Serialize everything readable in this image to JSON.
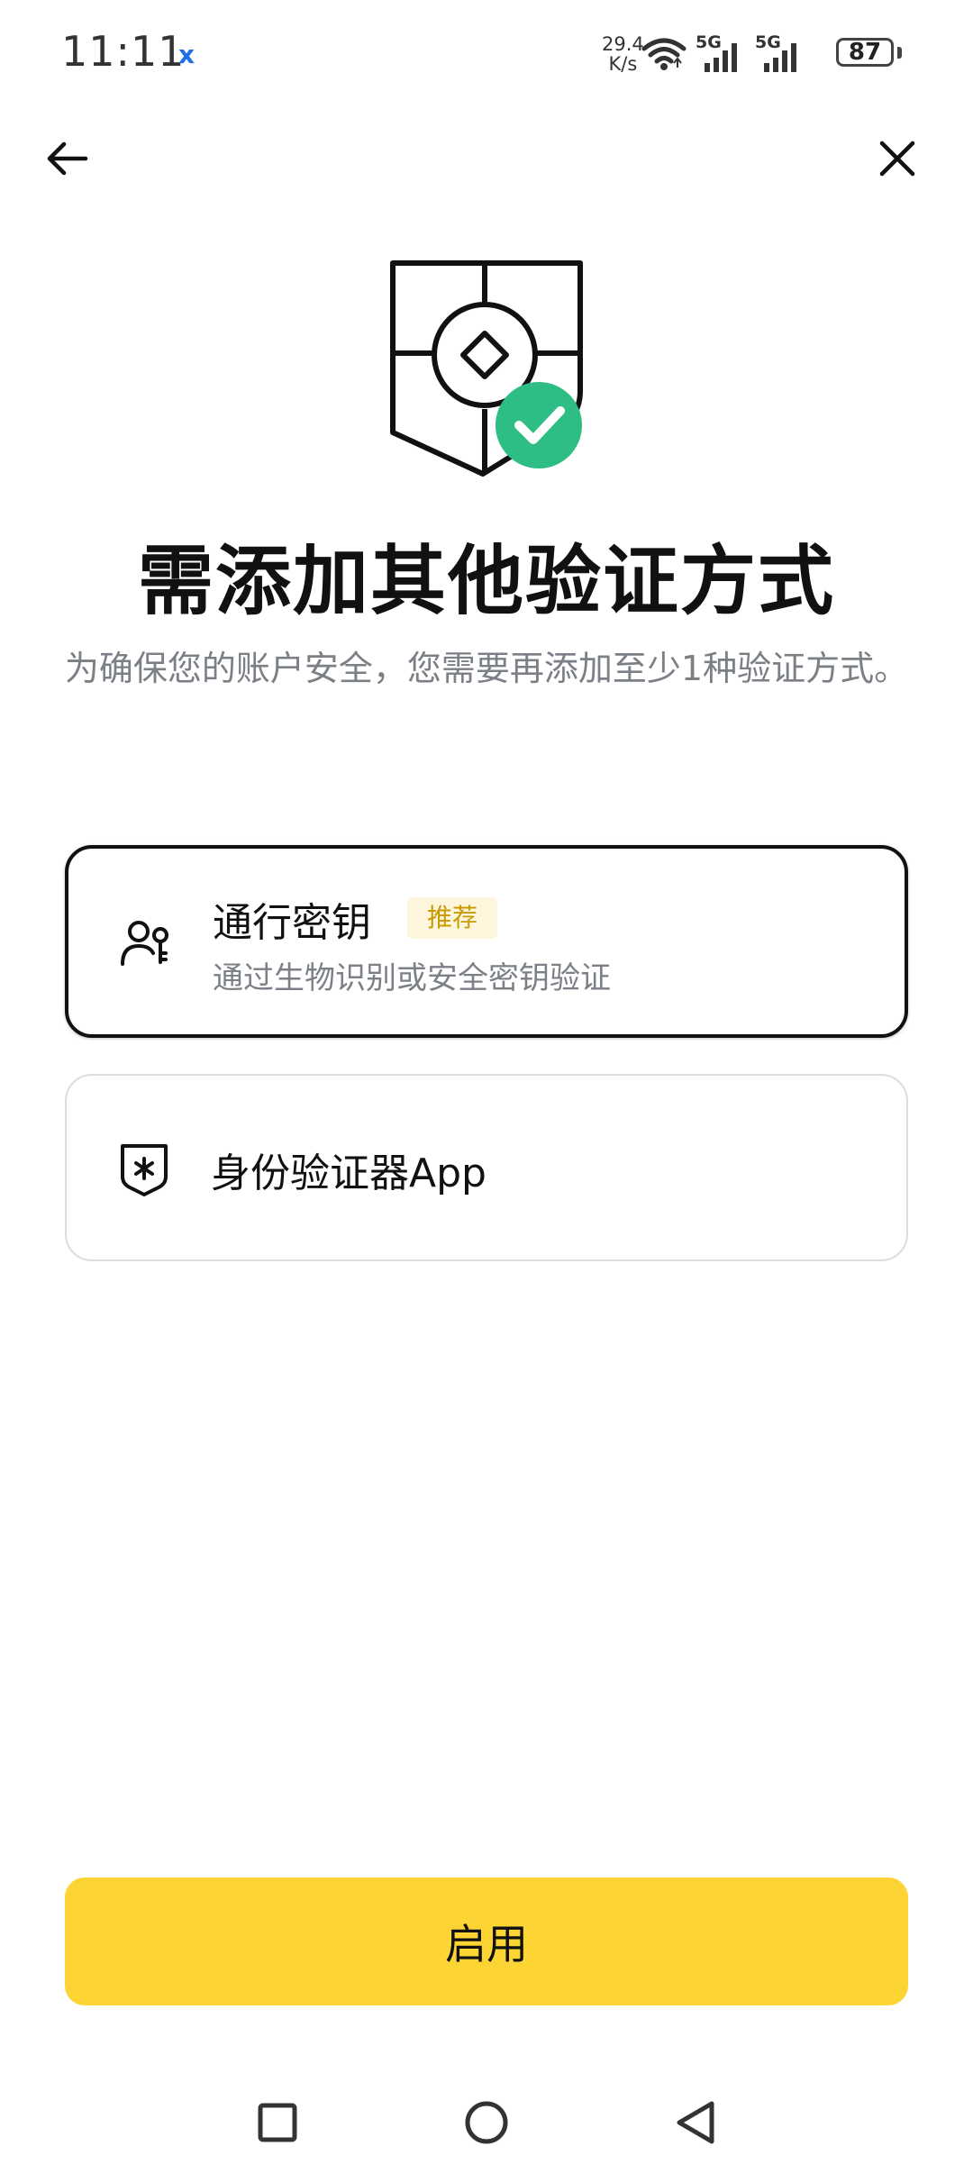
{
  "status_bar": {
    "time": "11:11",
    "notification_glyph": "x",
    "net_speed_value": "29.4",
    "net_speed_unit": "K/s",
    "signal1_label": "5G",
    "signal2_label": "5G",
    "battery_level": "87",
    "icons": [
      "wifi-icon",
      "signal-icon",
      "signal-icon",
      "battery-icon"
    ]
  },
  "header": {
    "back_icon": "arrow-left-icon",
    "close_icon": "close-icon"
  },
  "hero": {
    "icon": "shield-check-icon",
    "accent_color": "#2ebd85"
  },
  "title": "需添加其他验证方式",
  "subtitle": "为确保您的账户安全，您需要再添加至少1种验证方式。",
  "options": [
    {
      "icon": "passkey-icon",
      "title": "通行密钥",
      "badge": "推荐",
      "description": "通过生物识别或安全密钥验证",
      "selected": true
    },
    {
      "icon": "authenticator-shield-icon",
      "title": "身份验证器App",
      "selected": false
    }
  ],
  "primary_button": {
    "label": "启用",
    "color": "#fcd535"
  },
  "nav_bar": {
    "items": [
      "recents-square-icon",
      "home-circle-icon",
      "back-triangle-icon"
    ]
  }
}
